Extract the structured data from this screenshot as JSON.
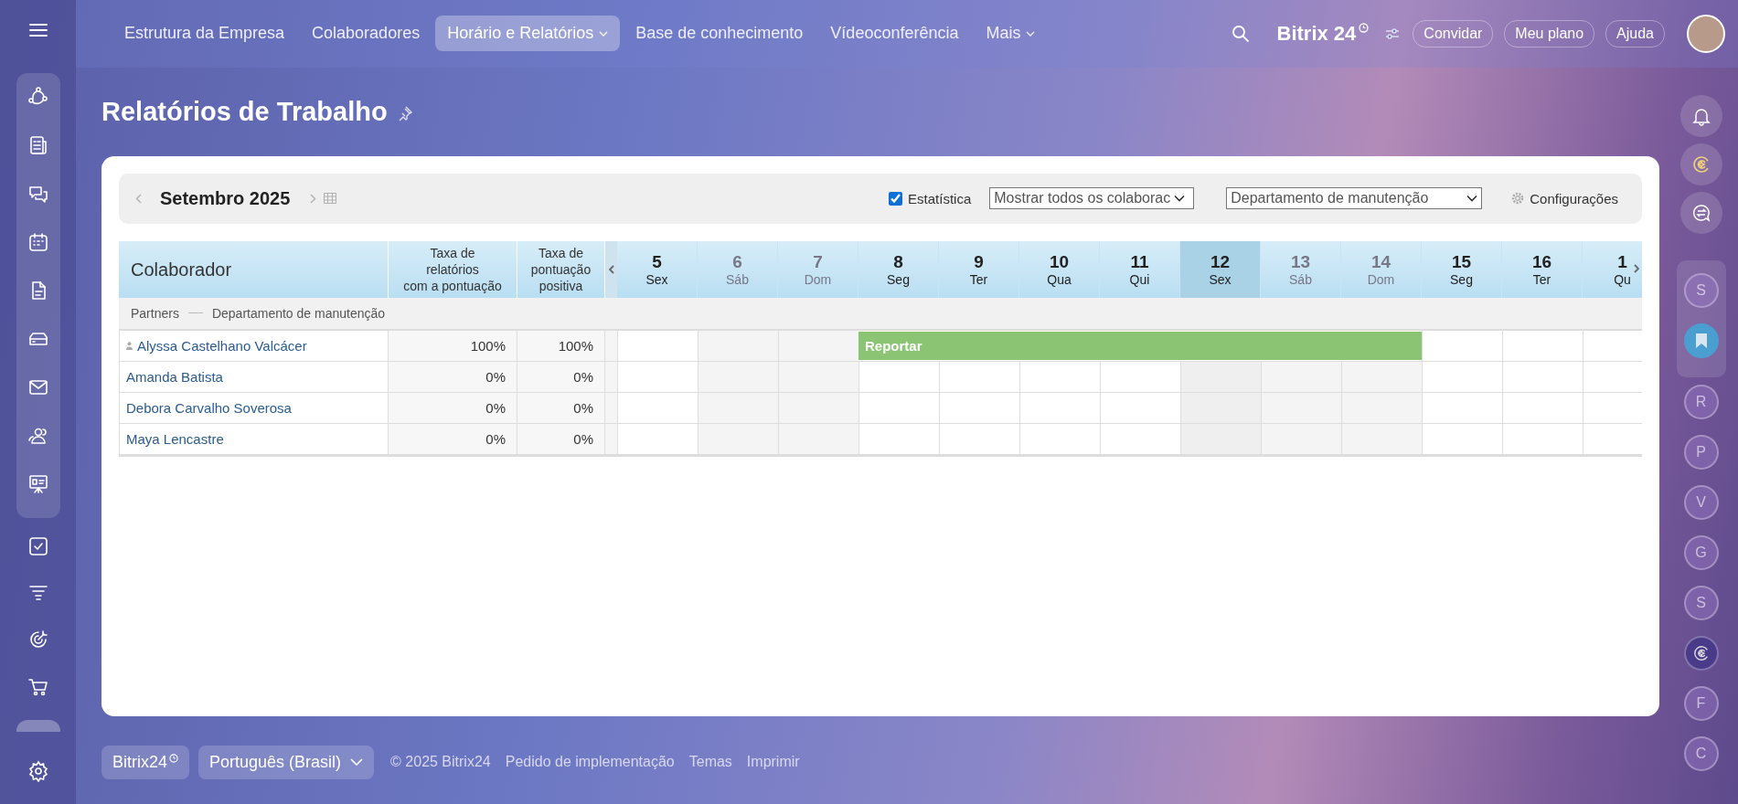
{
  "nav": {
    "items": [
      {
        "label": "Estrutura da Empresa",
        "selected": false,
        "dropdown": false
      },
      {
        "label": "Colaboradores",
        "selected": false,
        "dropdown": false
      },
      {
        "label": "Horário e Relatórios",
        "selected": true,
        "dropdown": true
      },
      {
        "label": "Base de conhecimento",
        "selected": false,
        "dropdown": false
      },
      {
        "label": "Vídeoconferência",
        "selected": false,
        "dropdown": false
      },
      {
        "label": "Mais",
        "selected": false,
        "dropdown": true
      }
    ]
  },
  "header": {
    "logo": "Bitrix",
    "logo_suffix": "24",
    "buttons": [
      "Convidar",
      "Meu plano",
      "Ajuda"
    ]
  },
  "page_title": "Relatórios de Trabalho",
  "toolbar": {
    "month": "Setembro 2025",
    "statistics": {
      "label": "Estatística",
      "checked": true
    },
    "filters": [
      {
        "value": "Mostrar todos os colaborac"
      },
      {
        "value": "Departamento de manutenção"
      }
    ],
    "settings": "Configurações"
  },
  "table": {
    "columns": [
      {
        "lines": [
          "Colaborador"
        ]
      },
      {
        "lines": [
          "Taxa de",
          "relatórios",
          "com a pontuação"
        ]
      },
      {
        "lines": [
          "Taxa de",
          "pontuação",
          "positiva"
        ]
      }
    ],
    "group": {
      "company": "Partners",
      "department": "Departamento de manutenção"
    },
    "days": [
      {
        "day": "5",
        "weekday": "Sex",
        "weekend": false,
        "today": false
      },
      {
        "day": "6",
        "weekday": "Sáb",
        "weekend": true,
        "today": false
      },
      {
        "day": "7",
        "weekday": "Dom",
        "weekend": true,
        "today": false
      },
      {
        "day": "8",
        "weekday": "Seg",
        "weekend": false,
        "today": false
      },
      {
        "day": "9",
        "weekday": "Ter",
        "weekend": false,
        "today": false
      },
      {
        "day": "10",
        "weekday": "Qua",
        "weekend": false,
        "today": false
      },
      {
        "day": "11",
        "weekday": "Qui",
        "weekend": false,
        "today": false
      },
      {
        "day": "12",
        "weekday": "Sex",
        "weekend": false,
        "today": true
      },
      {
        "day": "13",
        "weekday": "Sáb",
        "weekend": true,
        "today": false
      },
      {
        "day": "14",
        "weekday": "Dom",
        "weekend": true,
        "today": false
      },
      {
        "day": "15",
        "weekday": "Seg",
        "weekend": false,
        "today": false
      },
      {
        "day": "16",
        "weekday": "Ter",
        "weekend": false,
        "today": false
      },
      {
        "day": "1",
        "weekday": "Qu",
        "weekend": false,
        "today": false
      }
    ],
    "rows": [
      {
        "name": "Alyssa Castelhano Valcácer",
        "current_user": true,
        "rate_scored": "100%",
        "rate_positive": "100%",
        "report_label": "Reportar",
        "cells": [
          {
            "report": false
          },
          {
            "report": false
          },
          {
            "report": false
          },
          {
            "report": true
          },
          {
            "report": true
          },
          {
            "report": true
          },
          {
            "report": true
          },
          {
            "report": true
          },
          {
            "report": true
          },
          {
            "report": true
          },
          {
            "report": false
          },
          {
            "report": false
          },
          {
            "report": false
          }
        ]
      },
      {
        "name": "Amanda Batista",
        "current_user": false,
        "rate_scored": "0%",
        "rate_positive": "0%",
        "cells": [
          {
            "report": false
          },
          {
            "report": false
          },
          {
            "report": false
          },
          {
            "report": false
          },
          {
            "report": false
          },
          {
            "report": false
          },
          {
            "report": false
          },
          {
            "report": false
          },
          {
            "report": false
          },
          {
            "report": false
          },
          {
            "report": false
          },
          {
            "report": false
          },
          {
            "report": false
          }
        ]
      },
      {
        "name": "Debora Carvalho Soverosa",
        "current_user": false,
        "rate_scored": "0%",
        "rate_positive": "0%",
        "cells": [
          {
            "report": false
          },
          {
            "report": false
          },
          {
            "report": false
          },
          {
            "report": false
          },
          {
            "report": false
          },
          {
            "report": false
          },
          {
            "report": false
          },
          {
            "report": false
          },
          {
            "report": false
          },
          {
            "report": false
          },
          {
            "report": false
          },
          {
            "report": false
          },
          {
            "report": false
          }
        ]
      },
      {
        "name": "Maya Lencastre",
        "current_user": false,
        "rate_scored": "0%",
        "rate_positive": "0%",
        "cells": [
          {
            "report": false
          },
          {
            "report": false
          },
          {
            "report": false
          },
          {
            "report": false
          },
          {
            "report": false
          },
          {
            "report": false
          },
          {
            "report": false
          },
          {
            "report": false
          },
          {
            "report": false
          },
          {
            "report": false
          },
          {
            "report": false
          },
          {
            "report": false
          },
          {
            "report": false
          }
        ]
      }
    ]
  },
  "right_rail": [
    {
      "kind": "letter",
      "letter": "S"
    },
    {
      "kind": "bookmark"
    },
    {
      "kind": "letter",
      "letter": "R"
    },
    {
      "kind": "letter",
      "letter": "P"
    },
    {
      "kind": "letter",
      "letter": "V"
    },
    {
      "kind": "letter",
      "letter": "G"
    },
    {
      "kind": "letter",
      "letter": "S"
    },
    {
      "kind": "copilot"
    },
    {
      "kind": "letter",
      "letter": "F"
    },
    {
      "kind": "letter",
      "letter": "C"
    }
  ],
  "footer": {
    "brand": "Bitrix24",
    "language": "Português (Brasil)",
    "copyright": "© 2025 Bitrix24",
    "links": [
      "Pedido de implementação",
      "Temas",
      "Imprimir"
    ]
  }
}
